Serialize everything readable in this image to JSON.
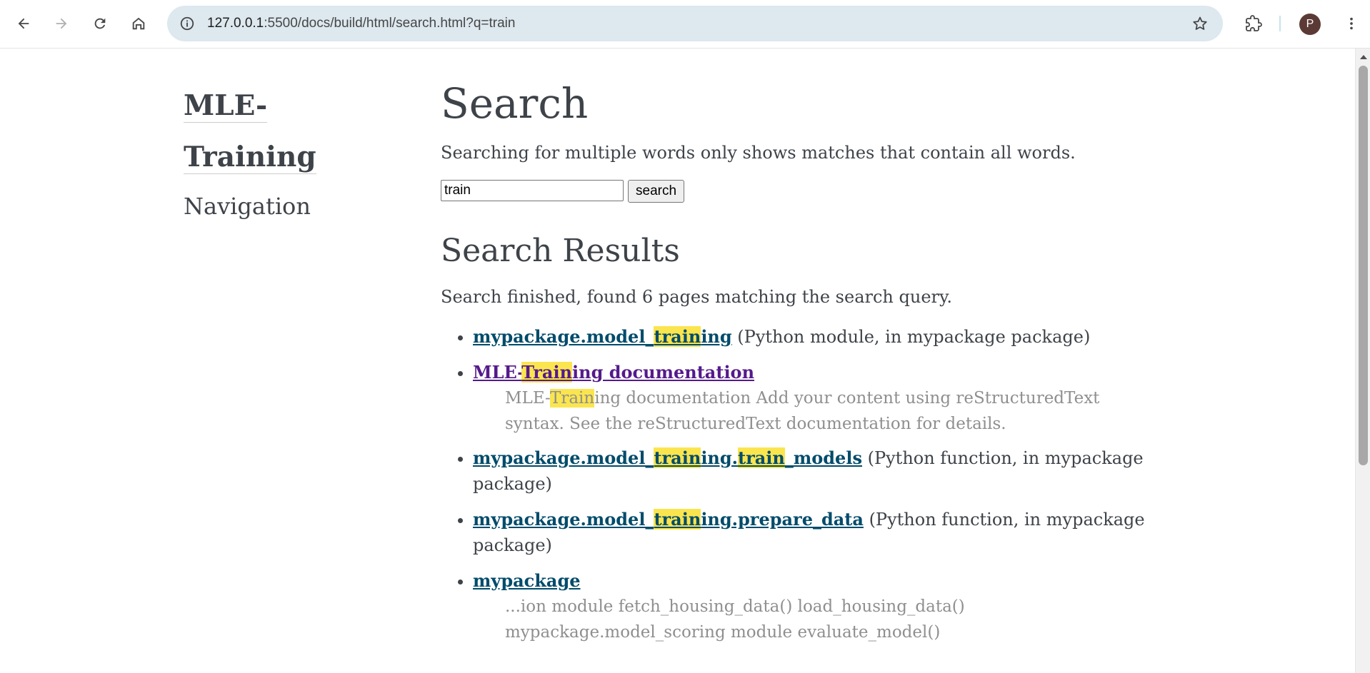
{
  "browser": {
    "url_host": "127.0.0.1",
    "url_rest": ":5500/docs/build/html/search.html?q=train",
    "avatar_letter": "P"
  },
  "sidebar": {
    "logo_line1": "MLE-",
    "logo_line2": "Training",
    "nav_heading": "Navigation"
  },
  "main": {
    "title": "Search",
    "intro": "Searching for multiple words only shows matches that contain all words.",
    "search_value": "train",
    "search_button": "search",
    "results_heading": "Search Results",
    "status": "Search finished, found 6 pages matching the search query."
  },
  "results": [
    {
      "link_parts": [
        "mypackage.model_",
        "train",
        "ing"
      ],
      "description": " (Python module, in mypackage package)",
      "visited": false
    },
    {
      "link_parts": [
        "MLE-",
        "Train",
        "ing documentation"
      ],
      "summary_parts": [
        "MLE-",
        "Train",
        "ing documentation Add your content using reStructuredText syntax. See the reStructuredText documentation for details."
      ],
      "visited": true
    },
    {
      "link_parts": [
        "mypackage.model_",
        "train",
        "ing.",
        "train",
        "_models"
      ],
      "description": " (Python function, in mypackage package)",
      "visited": false
    },
    {
      "link_parts": [
        "mypackage.model_",
        "train",
        "ing.prepare_data"
      ],
      "description": " (Python function, in mypackage package)",
      "visited": false
    },
    {
      "link_parts": [
        "mypackage"
      ],
      "summary_parts": [
        "...ion module fetch_housing_data() load_housing_data() mypackage.model_scoring module evaluate_model()"
      ],
      "visited": false
    }
  ]
}
